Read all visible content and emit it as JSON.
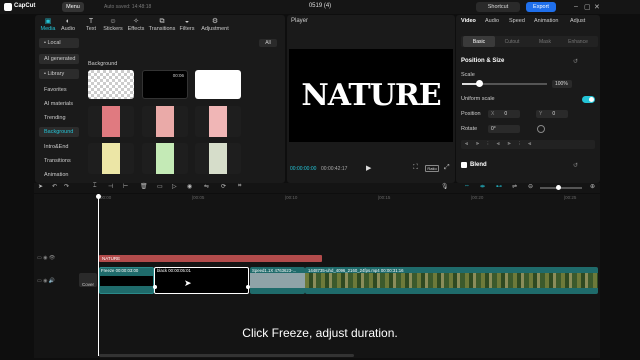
{
  "window": {
    "app_name": "CapCut",
    "menu_label": "Menu",
    "autosave": "Auto saved: 14:48:18",
    "project_title": "0519 (4)",
    "shortcut_label": "Shortcut",
    "export_label": "Export",
    "min": "–",
    "max": "▢",
    "close": "✕"
  },
  "media_tabs": [
    {
      "label": "Media",
      "icon": "▣"
    },
    {
      "label": "Audio",
      "icon": "◐"
    },
    {
      "label": "Text",
      "icon": "T"
    },
    {
      "label": "Stickers",
      "icon": "☺"
    },
    {
      "label": "Effects",
      "icon": "✧"
    },
    {
      "label": "Transitions",
      "icon": "⧉"
    },
    {
      "label": "Filters",
      "icon": "◒"
    },
    {
      "label": "Adjustment",
      "icon": "⚙"
    }
  ],
  "sidebar": {
    "local": "• Local",
    "ai_generated": "AI generated",
    "library": "• Library",
    "items": [
      "Favorites",
      "AI materials",
      "Trending",
      "Background",
      "Intro&End",
      "Transitions",
      "Animation"
    ]
  },
  "library": {
    "all_label": "All",
    "section_title": "Background",
    "first_duration": "00:06"
  },
  "player": {
    "title": "Player",
    "canvas_text": "NATURE",
    "current_time": "00:00:00:00",
    "total_time": "00:00:42:17",
    "ratio": "Ratio"
  },
  "inspector": {
    "tabs": [
      "Video",
      "Audio",
      "Speed",
      "Animation",
      "Adjust"
    ],
    "subtabs": [
      "Basic",
      "Cutout",
      "Mask",
      "Enhance"
    ],
    "position_size": "Position & Size",
    "scale_label": "Scale",
    "scale_value": "100%",
    "scale_level": 1.0,
    "uniform_scale": "Uniform scale",
    "uniform_on": true,
    "position_label": "Position",
    "pos_x": "0",
    "pos_y": "0",
    "rotate_label": "Rotate",
    "rotate_value": "0°",
    "blend_label": "Blend"
  },
  "timeline": {
    "ticks": [
      "00:00",
      "|00:05",
      "|00:10",
      "|00:15",
      "|00:20",
      "|00:25"
    ],
    "text_clip": "NATURE",
    "clip_freeze": "Freeze  00:00:03:00",
    "clip_black": "black  00:00:05:01",
    "clip_speed": "Speed1.1X  4763623-...",
    "clip_long": "1448735-uhd_4096_2160_24fps.mp4  00:00:31:16",
    "cover_label": "Cover"
  },
  "caption": "Click Freeze, adjust duration.",
  "colors": {
    "accent": "#24c4d6",
    "export": "#1f6feb",
    "text_clip": "#b24b4b",
    "video_clip": "#1f6b6b"
  }
}
